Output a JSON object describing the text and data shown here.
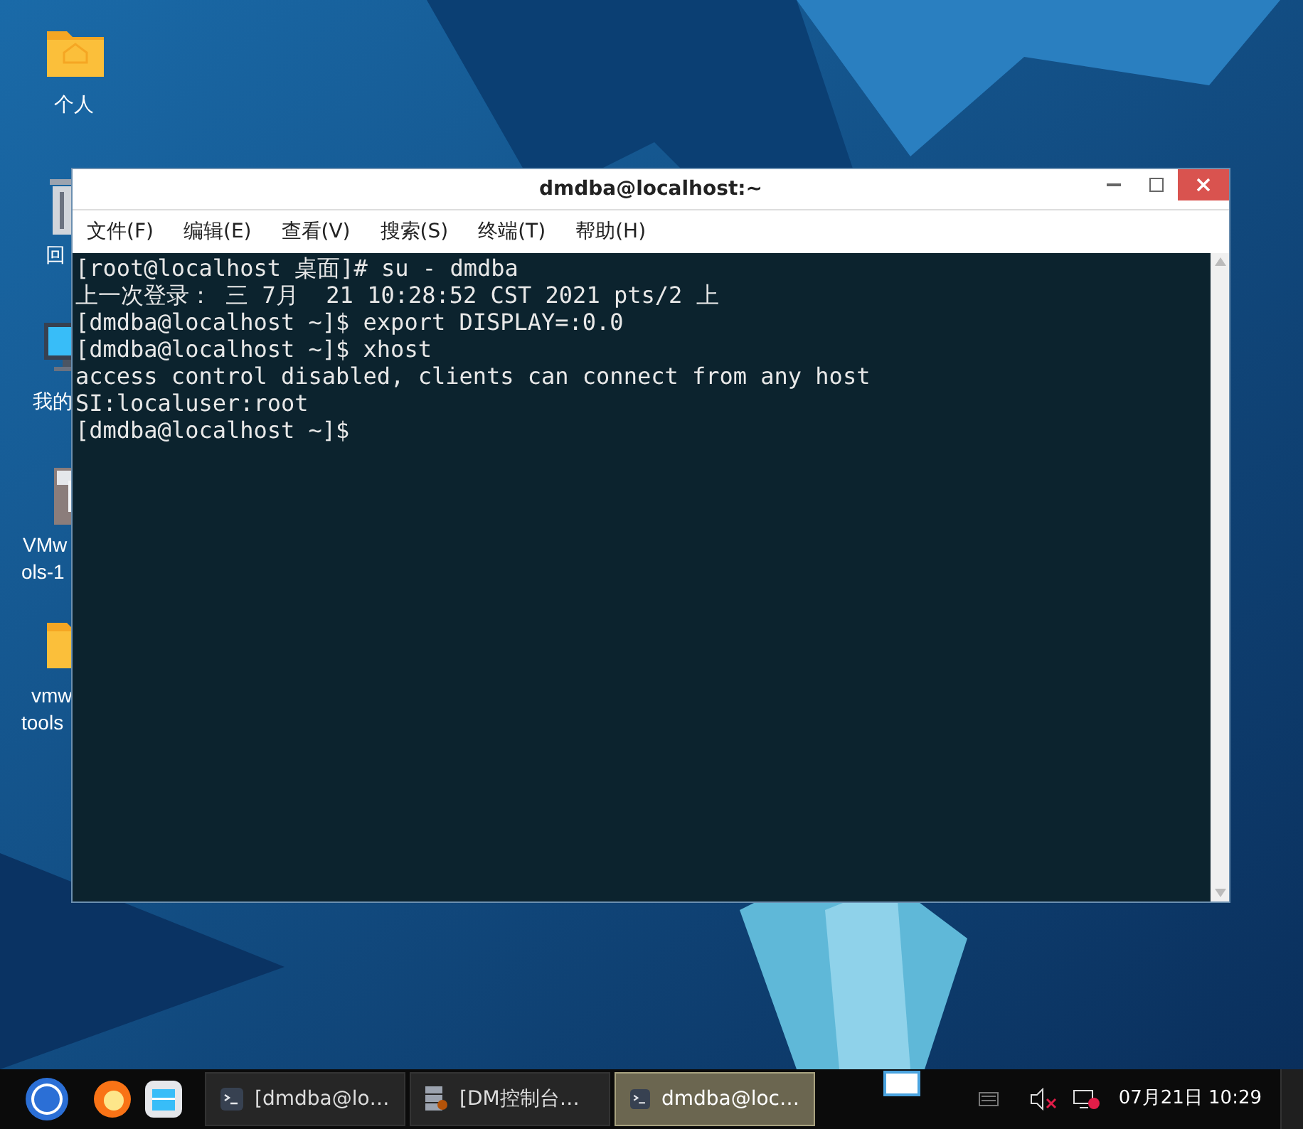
{
  "desktop": {
    "icons": [
      {
        "kind": "home-folder",
        "label": [
          "个人"
        ]
      },
      {
        "kind": "trash",
        "label": [
          "回"
        ]
      },
      {
        "kind": "computer",
        "label": [
          "我的"
        ]
      },
      {
        "kind": "archive",
        "label": [
          "VMw",
          "ols-1"
        ]
      },
      {
        "kind": "folder",
        "label": [
          "vmw",
          "tools"
        ]
      }
    ]
  },
  "window": {
    "title": "dmdba@localhost:~",
    "menu": [
      "文件(F)",
      "编辑(E)",
      "查看(V)",
      "搜索(S)",
      "终端(T)",
      "帮助(H)"
    ],
    "lines": [
      "[root@localhost 桌面]# su - dmdba",
      "上一次登录： 三 7月  21 10:28:52 CST 2021 pts/2 上",
      "[dmdba@localhost ~]$ export DISPLAY=:0.0",
      "[dmdba@localhost ~]$ xhost",
      "access control disabled, clients can connect from any host",
      "SI:localuser:root",
      "[dmdba@localhost ~]$"
    ]
  },
  "taskbar": {
    "tasks": [
      {
        "kind": "terminal",
        "title": "[dmdba@lo…",
        "selected": false
      },
      {
        "kind": "server",
        "title": "[DM控制台…",
        "selected": false
      },
      {
        "kind": "terminal",
        "title": "dmdba@loc…",
        "selected": true
      }
    ],
    "clock": "07月21日 10:29"
  }
}
